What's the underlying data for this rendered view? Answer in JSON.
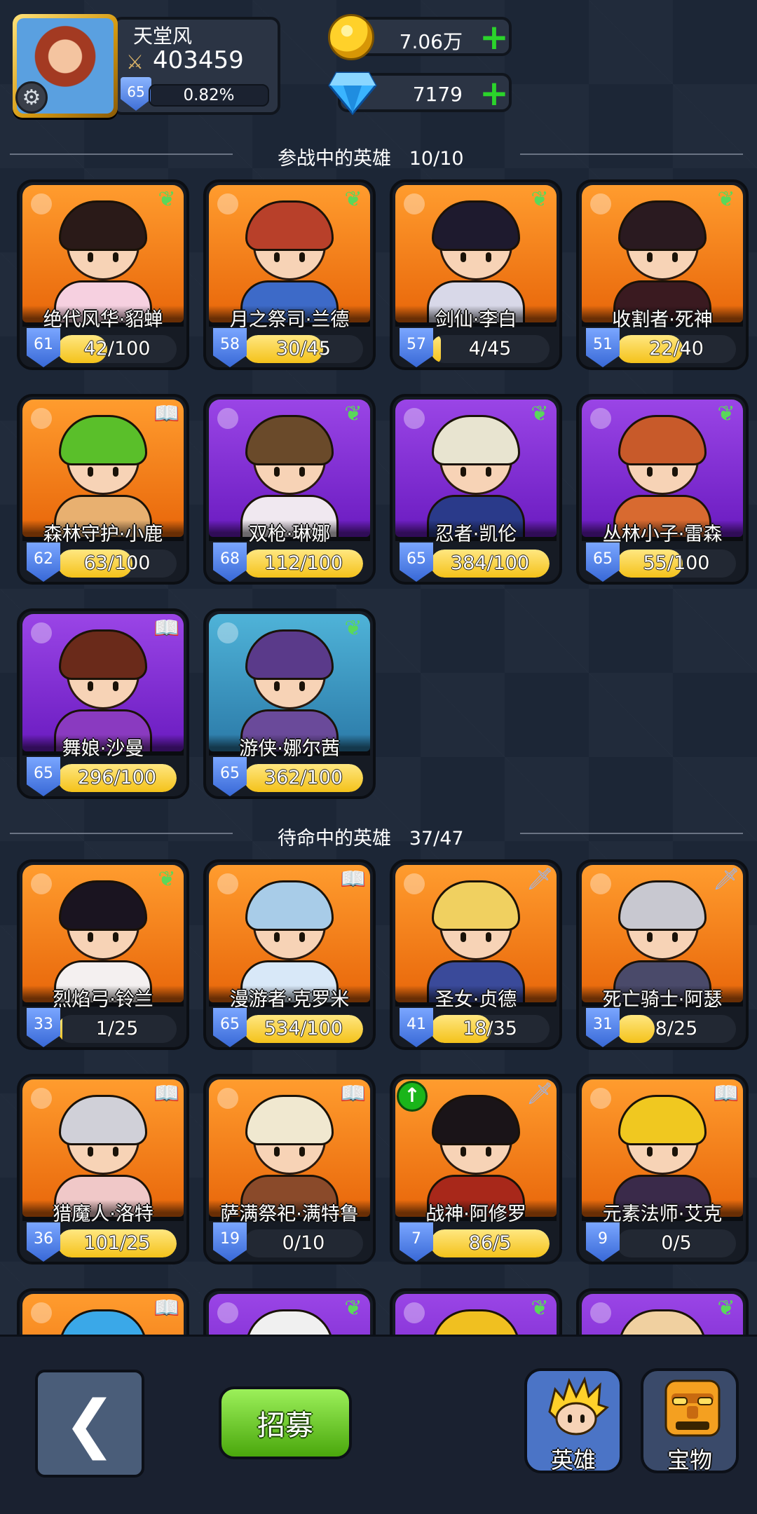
{
  "player": {
    "name": "天堂风",
    "power": "403459",
    "level": "65",
    "xp_percent": "0.82%",
    "xp_fraction": 0.0082
  },
  "currency": {
    "gold": "7.06万",
    "diamonds": "7179"
  },
  "sections": {
    "active": {
      "title": "参战中的英雄",
      "count": "10/10"
    },
    "reserve": {
      "title": "待命中的英雄",
      "count": "37/47"
    }
  },
  "active_heroes": [
    {
      "name": "绝代风华·貂蝉",
      "level": "61",
      "progress": "42/100",
      "fill": 0.42,
      "bg": "orange",
      "badge": "leaf",
      "hair": "#2a1a18",
      "body": "#f6d0e0"
    },
    {
      "name": "月之祭司·兰德",
      "level": "58",
      "progress": "30/45",
      "fill": 0.667,
      "bg": "orange",
      "badge": "leaf",
      "hair": "#b8402a",
      "body": "#3d6ac8"
    },
    {
      "name": "剑仙·李白",
      "level": "57",
      "progress": "4/45",
      "fill": 0.089,
      "bg": "orange",
      "badge": "leaf",
      "hair": "#1e1a2e",
      "body": "#d8d8e8"
    },
    {
      "name": "收割者·死神",
      "level": "51",
      "progress": "22/40",
      "fill": 0.55,
      "bg": "orange",
      "badge": "leaf",
      "hair": "#2a1a20",
      "body": "#3a1a20"
    },
    {
      "name": "森林守护·小鹿",
      "level": "62",
      "progress": "63/100",
      "fill": 0.63,
      "bg": "orange",
      "badge": "book",
      "hair": "#5abf2a",
      "body": "#e8b070"
    },
    {
      "name": "双枪·琳娜",
      "level": "68",
      "progress": "112/100",
      "fill": 1,
      "bg": "purple",
      "badge": "leaf",
      "hair": "#6a4a2a",
      "body": "#f0e8f0"
    },
    {
      "name": "忍者·凯伦",
      "level": "65",
      "progress": "384/100",
      "fill": 1,
      "bg": "purple",
      "badge": "leaf",
      "hair": "#e8e4d0",
      "body": "#2a3a8a"
    },
    {
      "name": "丛林小子·雷森",
      "level": "65",
      "progress": "55/100",
      "fill": 0.55,
      "bg": "purple",
      "badge": "leaf",
      "hair": "#c85a2a",
      "body": "#d86a30"
    },
    {
      "name": "舞娘·沙曼",
      "level": "65",
      "progress": "296/100",
      "fill": 1,
      "bg": "purple",
      "badge": "book",
      "hair": "#6a2a1a",
      "body": "#8a3ac0"
    },
    {
      "name": "游侠·娜尔茜",
      "level": "65",
      "progress": "362/100",
      "fill": 1,
      "bg": "blue",
      "badge": "leaf",
      "hair": "#5a3a8a",
      "body": "#6a4a9a"
    }
  ],
  "reserve_heroes": [
    {
      "name": "烈焰弓·铃兰",
      "level": "33",
      "progress": "1/25",
      "fill": 0.04,
      "bg": "orange",
      "badge": "leaf",
      "hair": "#1a1420",
      "body": "#f4f0f0"
    },
    {
      "name": "漫游者·克罗米",
      "level": "65",
      "progress": "534/100",
      "fill": 1,
      "bg": "orange",
      "badge": "book",
      "hair": "#a8cce8",
      "body": "#d8e8f8"
    },
    {
      "name": "圣女·贞德",
      "level": "41",
      "progress": "18/35",
      "fill": 0.514,
      "bg": "orange",
      "badge": "sword",
      "hair": "#f0d060",
      "body": "#3a4a9a"
    },
    {
      "name": "死亡骑士·阿瑟",
      "level": "31",
      "progress": "8/25",
      "fill": 0.32,
      "bg": "orange",
      "badge": "sword",
      "hair": "#c8c8d0",
      "body": "#4a4a6a"
    },
    {
      "name": "猎魔人·洛特",
      "level": "36",
      "progress": "101/25",
      "fill": 1,
      "bg": "orange",
      "badge": "book",
      "hair": "#d0d0d8",
      "body": "#f0c8c8"
    },
    {
      "name": "萨满祭祀·满特鲁",
      "level": "19",
      "progress": "0/10",
      "fill": 0,
      "bg": "orange",
      "badge": "book",
      "hair": "#f0e8d0",
      "body": "#8a4a2a"
    },
    {
      "name": "战神·阿修罗",
      "level": "7",
      "progress": "86/5",
      "fill": 1,
      "bg": "orange",
      "badge": "sword",
      "upgrade": true,
      "hair": "#1a1418",
      "body": "#a8281a"
    },
    {
      "name": "元素法师·艾克",
      "level": "9",
      "progress": "0/5",
      "fill": 0,
      "bg": "orange",
      "badge": "book",
      "hair": "#f0c820",
      "body": "#3a2a4a"
    },
    {
      "name": "",
      "level": "",
      "progress": "",
      "fill": 0,
      "bg": "orange",
      "badge": "book",
      "hair": "#3aa8e8",
      "body": "#3aa8e8"
    },
    {
      "name": "",
      "level": "",
      "progress": "",
      "fill": 0,
      "bg": "purple",
      "badge": "leaf",
      "hair": "#f0f0f0",
      "body": "#f0f0f0"
    },
    {
      "name": "",
      "level": "",
      "progress": "",
      "fill": 0,
      "bg": "purple",
      "badge": "leaf",
      "hair": "#f0c020",
      "body": "#f0c020"
    },
    {
      "name": "",
      "level": "",
      "progress": "",
      "fill": 0,
      "bg": "purple",
      "badge": "leaf",
      "hair": "#f0d0a0",
      "body": "#f0d0a0"
    }
  ],
  "bottom": {
    "recruit_label": "招募",
    "tab_heroes": "英雄",
    "tab_treasure": "宝物"
  },
  "badge_icons": {
    "leaf": "leaf-icon",
    "book": "book-icon",
    "sword": "sword-icon"
  },
  "colors": {
    "background": "#1c2636",
    "accent_gold": "#f4c21a",
    "accent_green": "#4aa70c",
    "card_orange": "#e8660a",
    "card_purple": "#6a1bc0",
    "card_blue": "#2b7aa8"
  }
}
